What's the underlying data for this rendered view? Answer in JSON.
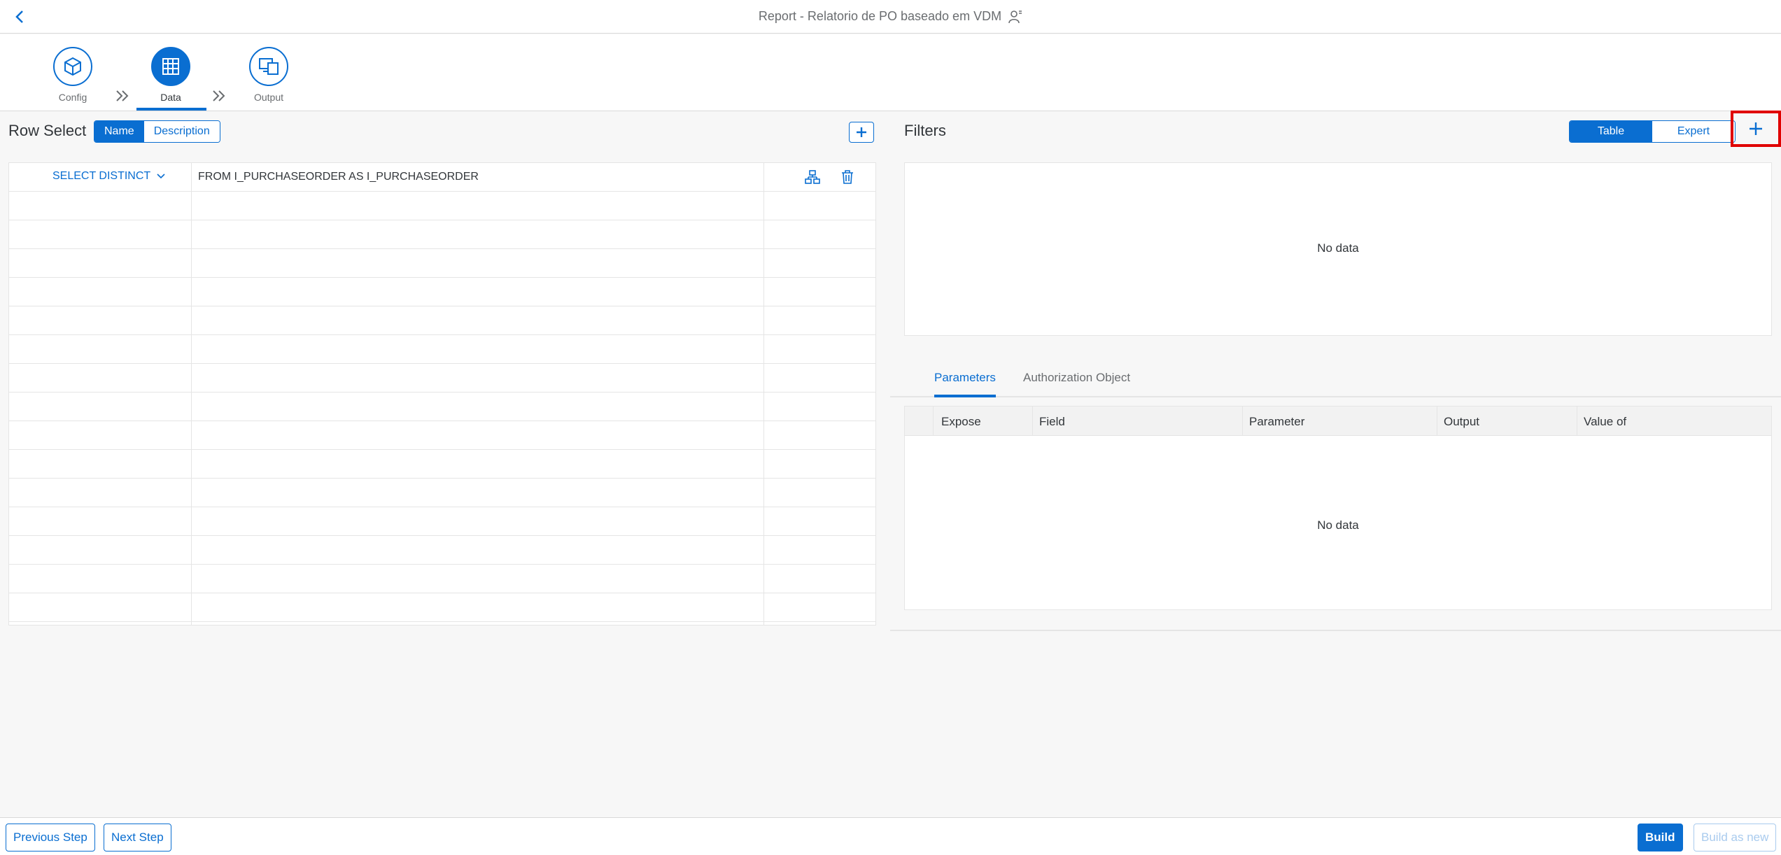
{
  "shell": {
    "title": "Report - Relatorio de PO baseado em VDM"
  },
  "wizard": {
    "steps": [
      {
        "label": "Config"
      },
      {
        "label": "Data"
      },
      {
        "label": "Output"
      }
    ],
    "active_step": "Data"
  },
  "row_select": {
    "title": "Row Select",
    "toggle": {
      "name": "Name",
      "description": "Description",
      "selected": "Name"
    },
    "rows": [
      {
        "select": "SELECT DISTINCT",
        "from": "FROM I_PURCHASEORDER AS I_PURCHASEORDER"
      }
    ]
  },
  "filters": {
    "title": "Filters",
    "toggle": {
      "table": "Table",
      "expert": "Expert",
      "selected": "Table"
    },
    "empty_text": "No data"
  },
  "tabs": {
    "items": [
      {
        "label": "Parameters"
      },
      {
        "label": "Authorization Object"
      }
    ],
    "selected": "Parameters"
  },
  "parameters_table": {
    "columns": [
      "Expose",
      "Field",
      "Parameter",
      "Output",
      "Value of"
    ],
    "empty_text": "No data"
  },
  "footer": {
    "previous": "Previous Step",
    "next": "Next Step",
    "build": "Build",
    "build_as_new": "Build as new"
  },
  "colors": {
    "accent": "#0a6ed1",
    "highlight": "#e00000"
  },
  "icons": [
    "back-icon",
    "user-icon",
    "config-icon",
    "table-grid-icon",
    "output-icon",
    "chevron-double-right-icon",
    "add-icon",
    "chevron-down-icon",
    "hierarchy-icon",
    "delete-icon"
  ]
}
